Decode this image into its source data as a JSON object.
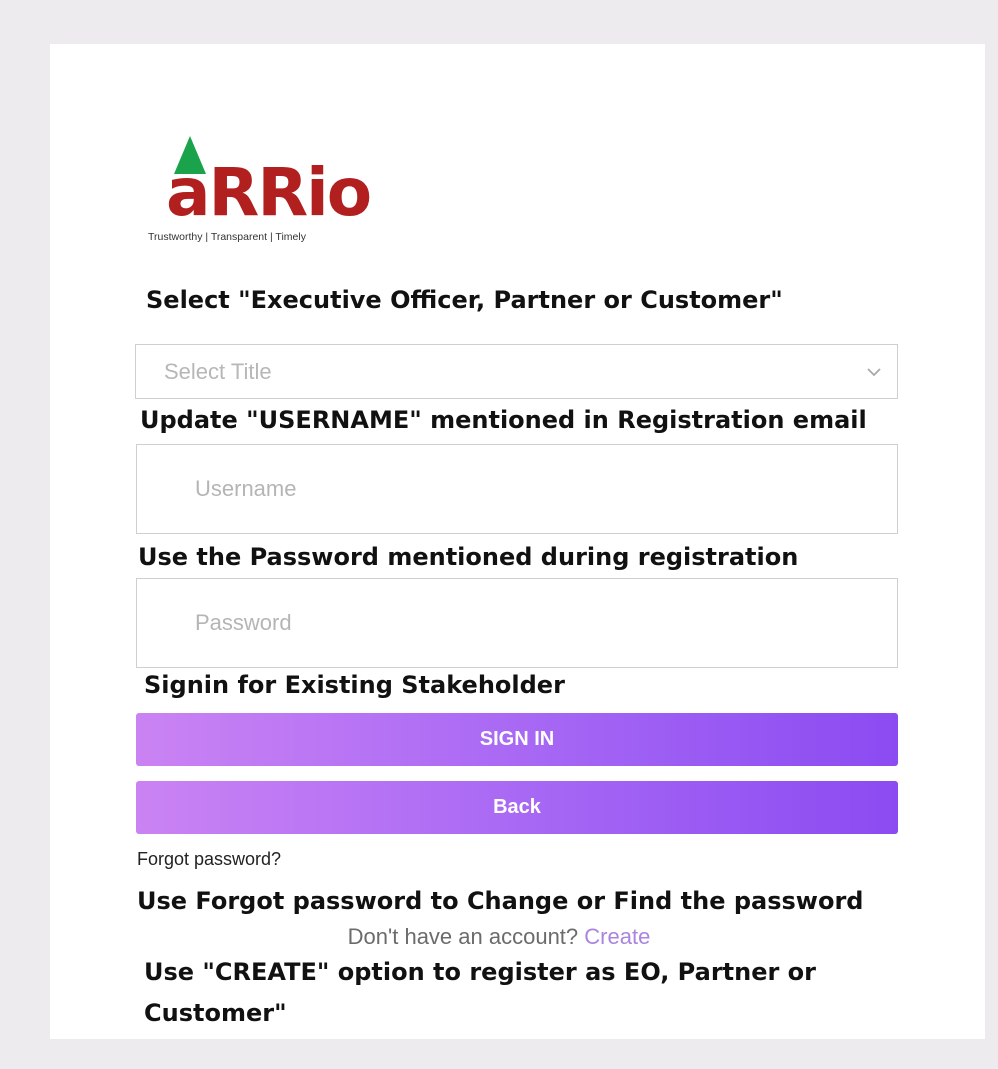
{
  "logo": {
    "brand": "aRRio",
    "tagline": "Trustworthy | Transparent | Timely",
    "brand_color": "#b21f1f",
    "arrow_color": "#1aa34a"
  },
  "annotations": {
    "select_hint": "Select \"Executive Officer, Partner or Customer\"",
    "username_hint": "Update \"USERNAME\" mentioned in Registration email",
    "password_hint": "Use the Password mentioned during registration",
    "signin_hint": "Signin for Existing Stakeholder",
    "forgot_hint": "Use Forgot password to Change or Find the password",
    "create_hint_line1": "Use \"CREATE\" option to register as EO, Partner or",
    "create_hint_line2": "Customer\""
  },
  "form": {
    "title_select": {
      "value": "Select Title",
      "icon": "chevron-down-icon"
    },
    "username": {
      "placeholder": "Username",
      "value": ""
    },
    "password": {
      "placeholder": "Password",
      "value": ""
    },
    "sign_in_label": "SIGN IN",
    "back_label": "Back",
    "forgot_password_label": "Forgot password?",
    "no_account_text": "Don't have an account?",
    "create_label": "Create"
  },
  "colors": {
    "button_gradient_start": "#cb83f3",
    "button_gradient_end": "#8b4bf2",
    "link_color": "#a985e0",
    "page_background": "#eeebef"
  }
}
